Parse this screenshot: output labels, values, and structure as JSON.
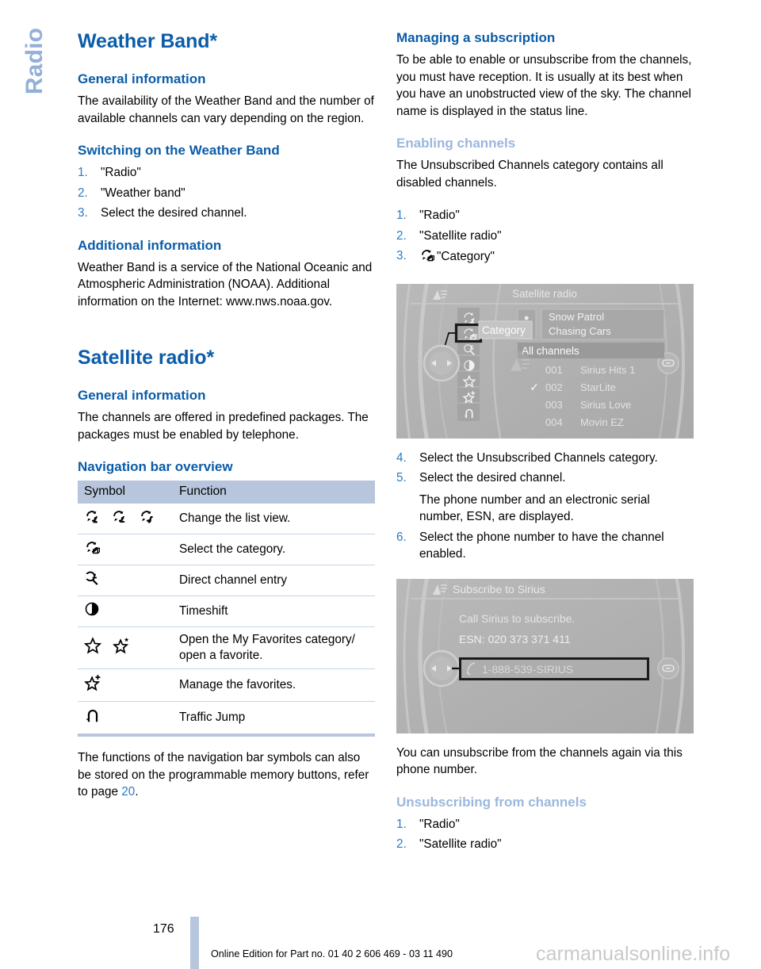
{
  "chapter_tab": "Radio",
  "left_column": {
    "title": "Weather Band*",
    "general_heading": "General information",
    "general_text": "The availability of the Weather Band and the number of available channels can vary depending on the region.",
    "switching_heading": "Switching on the Weather Band",
    "switching_steps": [
      {
        "num": "1.",
        "text": "\"Radio\""
      },
      {
        "num": "2.",
        "text": "\"Weather band\""
      },
      {
        "num": "3.",
        "text": "Select the desired channel."
      }
    ],
    "additional_heading": "Additional information",
    "additional_text": "Weather Band is a service of the National Oceanic and Atmospheric Administration (NOAA). Additional information on the Internet: www.nws.noaa.gov.",
    "satellite_title": "Satellite radio*",
    "satellite_general_heading": "General information",
    "satellite_general_text": "The channels are offered in predefined packages. The packages must be enabled by telephone.",
    "navbar_heading": "Navigation bar overview",
    "table": {
      "headers": [
        "Symbol",
        "Function"
      ],
      "rows": [
        {
          "icons": [
            "list-view-person-icon",
            "list-view-mic-icon",
            "list-view-music-icon"
          ],
          "function": "Change the list view."
        },
        {
          "icons": [
            "category-icon"
          ],
          "function": "Select the category."
        },
        {
          "icons": [
            "direct-channel-entry-icon"
          ],
          "function": "Direct channel entry"
        },
        {
          "icons": [
            "timeshift-icon"
          ],
          "function": "Timeshift"
        },
        {
          "icons": [
            "star-icon",
            "star-favorite-icon"
          ],
          "function": "Open the My Favorites category/ open a favorite."
        },
        {
          "icons": [
            "star-plus-icon"
          ],
          "function": "Manage the favorites."
        },
        {
          "icons": [
            "traffic-jump-icon"
          ],
          "function": "Traffic Jump"
        }
      ]
    },
    "closing_text_1": "The functions of the navigation bar symbols can also be stored on the programmable memory buttons, refer to page ",
    "closing_page_ref": "20",
    "closing_text_2": "."
  },
  "right_column": {
    "managing_heading": "Managing a subscription",
    "managing_text": "To be able to enable or unsubscribe from the channels, you must have reception. It is usually at its best when you have an unobstructed view of the sky. The channel name is displayed in the status line.",
    "enabling_heading": "Enabling channels",
    "enabling_text": "The Unsubscribed Channels category contains all disabled channels.",
    "enabling_steps": [
      {
        "num": "1.",
        "text": "\"Radio\"",
        "icon": ""
      },
      {
        "num": "2.",
        "text": "\"Satellite radio\"",
        "icon": ""
      },
      {
        "num": "3.",
        "text": "\"Category\"",
        "icon": "category-icon"
      }
    ],
    "steps_after": [
      {
        "num": "4.",
        "text": "Select the Unsubscribed Channels category."
      },
      {
        "num": "5.",
        "text": "Select the desired channel."
      },
      {
        "num": "",
        "text": "The phone number and an electronic serial number, ESN, are displayed."
      },
      {
        "num": "6.",
        "text": "Select the phone number to have the channel enabled."
      }
    ],
    "unsub_text": "You can unsubscribe from the channels again via this phone number.",
    "unsub_heading": "Unsubscribing from channels",
    "unsub_steps": [
      {
        "num": "1.",
        "text": "\"Radio\""
      },
      {
        "num": "2.",
        "text": "\"Satellite radio\""
      }
    ]
  },
  "idrive_screen_1": {
    "title": "Satellite radio",
    "tooltip": "Category",
    "now_playing_artist": "Snow Patrol",
    "now_playing_track": "Chasing Cars",
    "list_header": "All channels",
    "channels": [
      {
        "check": "",
        "num": "001",
        "name": "Sirius Hits 1"
      },
      {
        "check": "✓",
        "num": "002",
        "name": "StarLite"
      },
      {
        "check": "",
        "num": "003",
        "name": "Sirius Love"
      },
      {
        "check": "",
        "num": "004",
        "name": "Movin EZ"
      }
    ]
  },
  "idrive_screen_2": {
    "title": "Subscribe to Sirius",
    "line1": "Call Sirius to subscribe.",
    "line2": "ESN: 020 373 371 411",
    "phone_button": "1-888-539-SIRIUS"
  },
  "footer": {
    "page_number": "176",
    "edition_line": "Online Edition for Part no. 01 40 2 606 469 - 03 11 490",
    "watermark": "carmanualsonline.info"
  },
  "colors": {
    "heading_blue": "#0b5ca8",
    "light_blue": "#9ab8dd",
    "step_blue": "#2a7bc4",
    "table_header_bg": "#b7c6dd",
    "idrive_bg": "#b2b2b2"
  }
}
